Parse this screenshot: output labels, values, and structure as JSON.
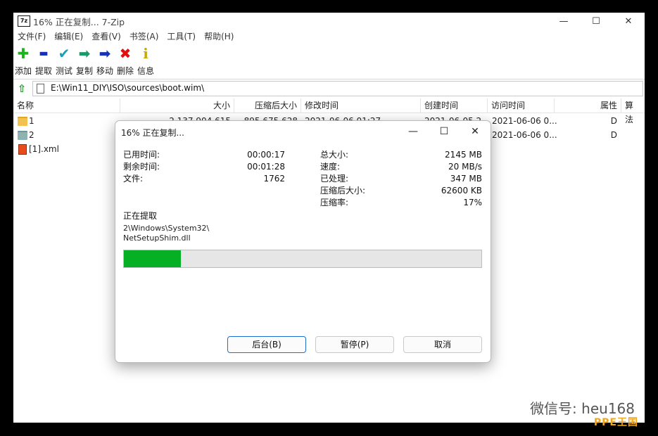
{
  "window": {
    "title": "16% 正在复制... 7-Zip",
    "icon_text": "7z",
    "controls": [
      "—",
      "☐",
      "✕"
    ]
  },
  "menu": [
    "文件(F)",
    "编辑(E)",
    "查看(V)",
    "书签(A)",
    "工具(T)",
    "帮助(H)"
  ],
  "toolbar": [
    {
      "label": "添加",
      "icon": "add-icon",
      "glyph": "✚",
      "color": "#1fb21f"
    },
    {
      "label": "提取",
      "icon": "extract-icon",
      "glyph": "▬",
      "color": "#1633b8"
    },
    {
      "label": "测试",
      "icon": "test-icon",
      "glyph": "✔",
      "color": "#18a0b8"
    },
    {
      "label": "复制",
      "icon": "copy-icon",
      "glyph": "➡",
      "color": "#1a9a6a"
    },
    {
      "label": "移动",
      "icon": "move-icon",
      "glyph": "➡",
      "color": "#1633b8"
    },
    {
      "label": "删除",
      "icon": "delete-icon",
      "glyph": "✖",
      "color": "#e01010"
    },
    {
      "label": "信息",
      "icon": "info-icon",
      "glyph": "i",
      "color": "#c9a800"
    }
  ],
  "address": {
    "path": "E:\\Win11_DIY\\ISO\\sources\\boot.wim\\"
  },
  "columns": [
    "名称",
    "大小",
    "压缩后大小",
    "修改时间",
    "创建时间",
    "访问时间",
    "属性",
    "算法"
  ],
  "rows": [
    {
      "name": "1",
      "icon": "folder-icon",
      "size": "2 137 904 615",
      "packed": "895 675 628",
      "modified": "2021-06-06 01:27",
      "created": "2021-06-05 2...",
      "accessed": "2021-06-06 0...",
      "attr": "D",
      "method": ""
    },
    {
      "name": "2",
      "icon": "folder-icon",
      "size": "",
      "packed": "",
      "modified": "",
      "created": "",
      "accessed": "2021-06-06 0...",
      "attr": "D",
      "method": ""
    },
    {
      "name": "[1].xml",
      "icon": "xml-file-icon",
      "size": "",
      "packed": "",
      "modified": "",
      "created": "",
      "accessed": "",
      "attr": "",
      "method": ""
    }
  ],
  "dialog": {
    "title": "16% 正在复制...",
    "controls": [
      "—",
      "☐",
      "✕"
    ],
    "left": [
      {
        "label": "已用时间:",
        "value": "00:00:17"
      },
      {
        "label": "剩余时间:",
        "value": "00:01:28"
      },
      {
        "label": "文件:",
        "value": "1762"
      }
    ],
    "right": [
      {
        "label": "总大小:",
        "value": "2145 MB"
      },
      {
        "label": "速度:",
        "value": "20 MB/s"
      },
      {
        "label": "已处理:",
        "value": "347 MB"
      },
      {
        "label": "压缩后大小:",
        "value": "62600 KB"
      },
      {
        "label": "压缩率:",
        "value": "17%"
      }
    ],
    "section_title": "正在提取",
    "current_path_line1": "2\\Windows\\System32\\",
    "current_path_line2": "NetSetupShim.dll",
    "progress": 0.16,
    "buttons": {
      "background": "后台(B)",
      "pause": "暂停(P)",
      "cancel": "取消"
    }
  },
  "watermark": {
    "text": "微信号: heu168",
    "badge": "PPE王国"
  }
}
